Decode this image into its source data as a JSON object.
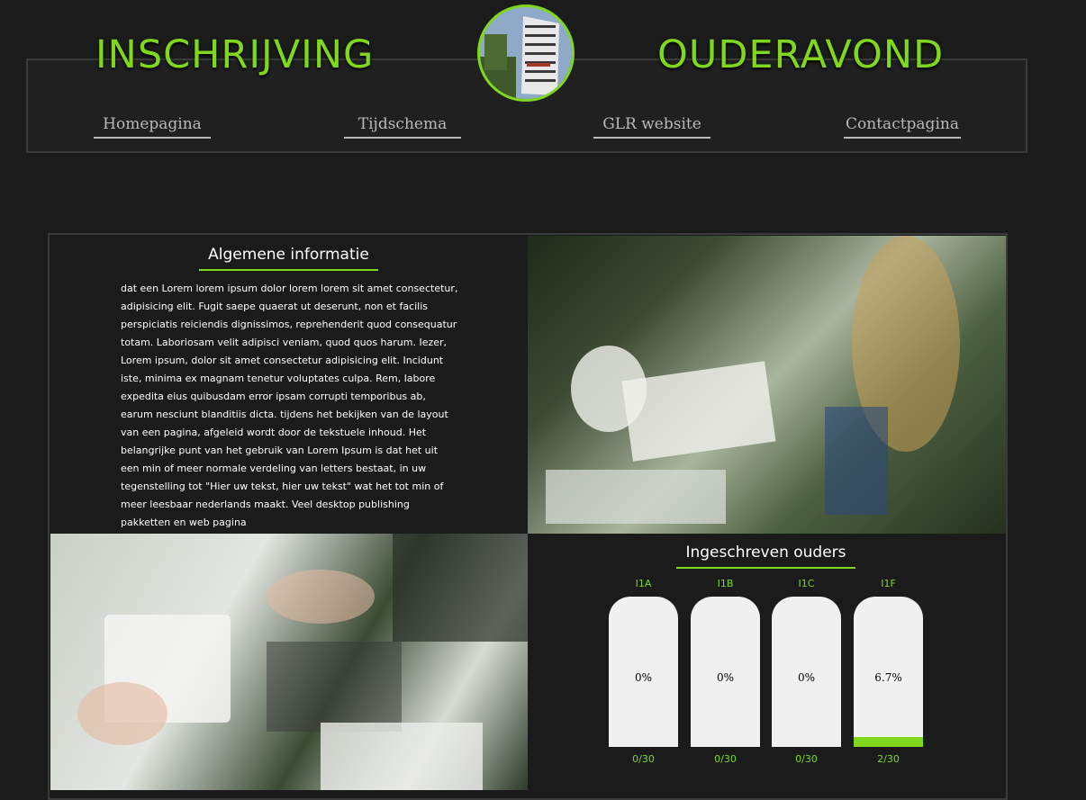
{
  "header": {
    "title_left": "INSCHRIJVING",
    "title_right": "OUDERAVOND",
    "nav": [
      "Homepagina",
      "Tijdschema",
      "GLR website",
      "Contactpagina"
    ]
  },
  "info": {
    "title": "Algemene informatie",
    "text": "dat een Lorem lorem ipsum dolor lorem lorem sit amet consectetur, adipisicing elit. Fugit saepe quaerat ut deserunt, non et facilis perspiciatis reiciendis dignissimos, reprehenderit quod consequatur totam. Laboriosam velit adipisci veniam, quod quos harum. Iezer, Lorem ipsum, dolor sit amet consectetur adipisicing elit. Incidunt iste, minima ex magnam tenetur voluptates culpa. Rem, labore expedita eius quibusdam error ipsam corrupti temporibus ab, earum nesciunt blanditiis dicta. tijdens het bekijken van de layout van een pagina, afgeleid wordt door de tekstuele inhoud. Het belangrijke punt van het gebruik van Lorem Ipsum is dat het uit een min of meer normale verdeling van letters bestaat, in uw tegenstelling tot \"Hier uw tekst, hier uw tekst\" wat het tot min of meer leesbaar nederlands maakt. Veel desktop publishing pakketten en web pagina"
  },
  "registrations": {
    "title": "Ingeschreven ouders",
    "classes": [
      {
        "name": "I1A",
        "percent": "0%",
        "count": "0/30",
        "fill": 0
      },
      {
        "name": "I1B",
        "percent": "0%",
        "count": "0/30",
        "fill": 0
      },
      {
        "name": "I1C",
        "percent": "0%",
        "count": "0/30",
        "fill": 0
      },
      {
        "name": "I1F",
        "percent": "6.7%",
        "count": "2/30",
        "fill": 0.067
      }
    ]
  },
  "colors": {
    "accent": "#7fd81b",
    "background": "#1b1b1b"
  }
}
